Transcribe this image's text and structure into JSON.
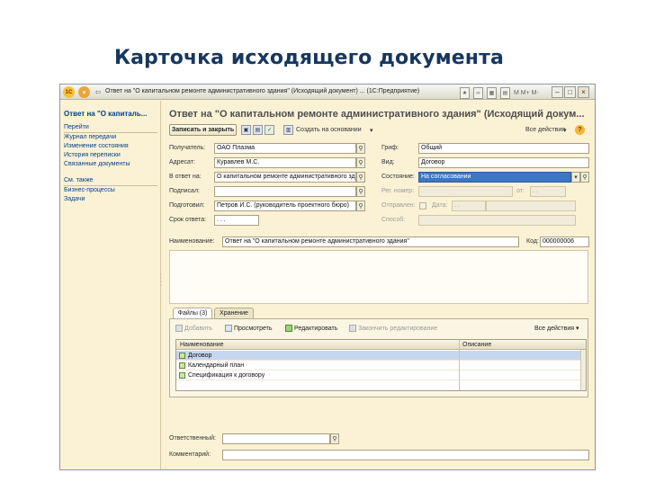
{
  "slide_title": "Карточка исходящего документа",
  "window": {
    "title": "Ответ на \"О капитальном ремонте административного здания\" (Исходящий документ) ... (1С:Предприятие)",
    "logo": "1С",
    "toolbar_text": "M  M+  M-"
  },
  "sidebar": {
    "header": "Ответ на \"О капиталь...",
    "section_goto": "Перейти",
    "goto_items": [
      "Журнал передачи",
      "Изменение состояния",
      "История переписки",
      "Связанные документы"
    ],
    "section_see_also": "См. также",
    "see_also_items": [
      "Бизнес-процессы",
      "Задачи"
    ]
  },
  "doc": {
    "title": "Ответ на \"О капитальном ремонте административного здания\" (Исходящий докум...",
    "actions": {
      "save_close": "Записать и закрыть",
      "create_based": "Создать на основании",
      "all_actions": "Все действия",
      "help": "?"
    },
    "fields": {
      "recipient_label": "Получатель:",
      "recipient_value": "ОАО Плазма",
      "addressee_label": "Адресат:",
      "addressee_value": "Куравлев М.С.",
      "reply_label": "В ответ на:",
      "reply_value": "О капитальном ремонте административного зд",
      "signed_label": "Подписал:",
      "signed_value": "",
      "prepared_label": "Подготовил:",
      "prepared_value": "Петров И.С. (руководитель проектного бюро)",
      "deadline_label": "Срок ответа:",
      "deadline_value": ". . .",
      "grif_label": "Гриф:",
      "grif_value": "Общий",
      "kind_label": "Вид:",
      "kind_value": "Договор",
      "state_label": "Состояние:",
      "state_value": "На согласовании",
      "reg_label": "Рег. номер:",
      "from_label": "от:",
      "from_value": ". .",
      "sent_label": "Отправлен:",
      "date_label": "Дата:",
      "date_value": ". .",
      "method_label": "Способ:",
      "name_label": "Наименование:",
      "name_value": "Ответ на \"О капитальном ремонте административного здания\"",
      "code_label": "Код:",
      "code_value": "000000006",
      "responsible_label": "Ответственный:",
      "comment_label": "Комментарий:"
    },
    "tabs": [
      "Файлы (3)",
      "Хранение"
    ],
    "files_toolbar": {
      "add": "Добавить",
      "view": "Просмотреть",
      "edit": "Редактировать",
      "finish": "Закончить редактирование",
      "all_actions": "Все действия"
    },
    "files_table": {
      "columns": [
        "Наименование",
        "Описание"
      ],
      "rows": [
        {
          "name": "Договор",
          "desc": ""
        },
        {
          "name": "Календарный план",
          "desc": ""
        },
        {
          "name": "Спецификация к договору",
          "desc": ""
        }
      ]
    }
  },
  "icons": {
    "search": "magnifier-icon",
    "dropdown": "chevron-down-icon"
  },
  "colors": {
    "title": "#17375e",
    "window_bg": "#fbf2d6",
    "link": "#003f8a",
    "selection": "#3c76c4"
  }
}
